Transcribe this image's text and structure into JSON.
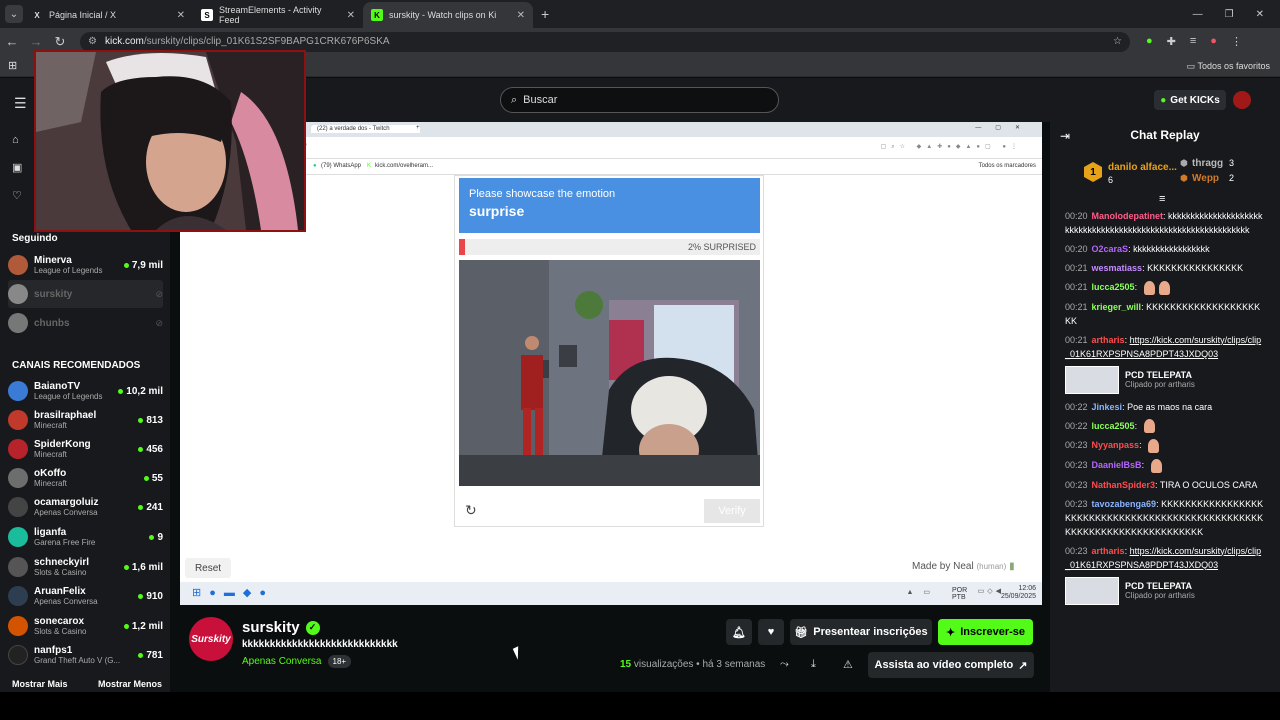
{
  "browser": {
    "tabs": [
      {
        "label": "Página Inicial / X",
        "favicon": "X"
      },
      {
        "label": "StreamElements - Activity Feed",
        "favicon": "S"
      },
      {
        "label": "surskity - Watch clips on Ki",
        "favicon": "K"
      }
    ],
    "url_domain": "kick.com",
    "url_path": "/surskity/clips/clip_01K61S2SF9BAPG1CRK676P6SKA",
    "bookmarks_all": "Todos os favoritos"
  },
  "kick_header": {
    "search_placeholder": "Buscar",
    "get_kicks": "Get KICKs"
  },
  "sidebar": {
    "following_title": "Seguindo",
    "following": [
      {
        "name": "Minerva",
        "game": "League of Legends",
        "viewers": "7,9 mil",
        "live": true,
        "color": "#b05a3a"
      },
      {
        "name": "surskity",
        "game": "",
        "viewers": "",
        "live": false,
        "color": "#888"
      },
      {
        "name": "chunbs",
        "game": "",
        "viewers": "",
        "live": false,
        "color": "#777"
      }
    ],
    "recommended_title": "CANAIS RECOMENDADOS",
    "recommended": [
      {
        "name": "BaianoTV",
        "game": "League of Legends",
        "viewers": "10,2 mil",
        "color": "#3a7bd5"
      },
      {
        "name": "brasilraphael",
        "game": "Minecraft",
        "viewers": "813",
        "color": "#c0392b"
      },
      {
        "name": "SpiderKong",
        "game": "Minecraft",
        "viewers": "456",
        "color": "#b7232a"
      },
      {
        "name": "oKoffo",
        "game": "Minecraft",
        "viewers": "55",
        "color": "#6d6d6d"
      },
      {
        "name": "ocamargoluiz",
        "game": "Apenas Conversa",
        "viewers": "241",
        "color": "#444"
      },
      {
        "name": "liganfa",
        "game": "Garena Free Fire",
        "viewers": "9",
        "color": "#1abc9c"
      },
      {
        "name": "schneckyirl",
        "game": "Slots & Casino",
        "viewers": "1,6 mil",
        "color": "#555"
      },
      {
        "name": "AruanFelix",
        "game": "Apenas Conversa",
        "viewers": "910",
        "color": "#2c3e50"
      },
      {
        "name": "sonecarox",
        "game": "Slots & Casino",
        "viewers": "1,2 mil",
        "color": "#d35400"
      },
      {
        "name": "nanfps1",
        "game": "Grand Theft Auto V (G...",
        "viewers": "781",
        "color": "#222"
      }
    ],
    "show_more": "Mostrar Mais",
    "show_less": "Mostrar Menos"
  },
  "video": {
    "inner_tab": "(22) a verdade dos - Twitch",
    "inner_bookmarks": [
      "(79) WhatsApp",
      "kick.com/ovelheram..."
    ],
    "inner_bookmarks_all": "Todos os marcadores",
    "captcha_prompt": "Please showcase the emotion",
    "captcha_emotion": "surprise",
    "progress_label": "2% SURPRISED",
    "progress_fraction": 0.02,
    "verify": "Verify",
    "reset": "Reset",
    "made_by": "Made by Neal",
    "made_by_note": "(human)",
    "taskbar_lang": "POR PTB",
    "taskbar_time": "12:06",
    "taskbar_date": "25/09/2025"
  },
  "stream_info": {
    "streamer": "surskity",
    "title": "kkkkkkkkkkkkkkkkkkkkkkkkkkkk",
    "category": "Apenas Conversa",
    "age": "18+",
    "gift_subs": "Presentear inscrições",
    "subscribe": "Inscrever-se",
    "views_count": "15",
    "views_label": "visualizações",
    "time_ago": "• há 3 semanas",
    "watch_full": "Assista ao vídeo completo"
  },
  "chat": {
    "title": "Chat Replay",
    "leaderboard": [
      {
        "rank": "1",
        "name": "danilo alface...",
        "count": "6"
      },
      {
        "name": "thragg",
        "count": "3"
      },
      {
        "name": "Wepp",
        "count": "2"
      }
    ],
    "messages": [
      {
        "ts": "00:20",
        "user": "Manolodepatinet",
        "color": "#ff5c8a",
        "text": "kkkkkkkkkkkkkkkkkkkkkkkkkkkkkkkkkkkkkkkkkkkkkkkkkkkkkkkkkkkkkk"
      },
      {
        "ts": "00:20",
        "user": "O2caraS",
        "color": "#b565ff",
        "text": "kkkkkkkkkkkkkkkkk"
      },
      {
        "ts": "00:21",
        "user": "wesmatiass",
        "color": "#c58cff",
        "text": "KKKKKKKKKKKKKKKK"
      },
      {
        "ts": "00:21",
        "user": "lucca2505",
        "color": "#8aff5c",
        "text": "",
        "emotes": 2
      },
      {
        "ts": "00:21",
        "user": "krieger_will",
        "color": "#8aff5c",
        "text": "KKKKKKKKKKKKKKKKKKKKK"
      },
      {
        "ts": "00:21",
        "user": "artharis",
        "color": "#ff4d4d",
        "text": "",
        "link": "https://kick.com/surskity/clips/clip_01K61RXPSPNSA8PDPT43JXDQ03"
      },
      {
        "clip": true,
        "clip_title": "PCD TELEPATA",
        "clip_sub": "Clipado por artharis"
      },
      {
        "ts": "00:22",
        "user": "Jinkesi",
        "color": "#8ab4ff",
        "text": "Poe as maos na cara"
      },
      {
        "ts": "00:22",
        "user": "lucca2505",
        "color": "#8aff5c",
        "text": "",
        "emotes": 1
      },
      {
        "ts": "00:23",
        "user": "Nyyanpass",
        "color": "#ff4d4d",
        "text": "",
        "emotes": 1
      },
      {
        "ts": "00:23",
        "user": "DaanielBsB",
        "color": "#b565ff",
        "text": "",
        "emotes": 1
      },
      {
        "ts": "00:23",
        "user": "NathanSpider3",
        "color": "#ff4d4d",
        "text": "TIRA O OCULOS CARA"
      },
      {
        "ts": "00:23",
        "user": "tavozabenga69",
        "color": "#8ab4ff",
        "text": "KKKKKKKKKKKKKKKKKKKKKKKKKKKKKKKKKKKKKKKKKKKKKKKKKKKKKKKKKKKKKKKKKKKKKKKKK"
      },
      {
        "ts": "00:23",
        "user": "artharis",
        "color": "#ff4d4d",
        "text": "",
        "link": "https://kick.com/surskity/clips/clip_01K61RXPSPNSA8PDPT43JXDQ03"
      },
      {
        "clip": true,
        "clip_title": "PCD TELEPATA",
        "clip_sub": "Clipado por artharis"
      }
    ]
  },
  "colors": {
    "kick_green": "#53fc18",
    "captcha_blue": "#4a90e2",
    "progress_red": "#e8464c"
  }
}
